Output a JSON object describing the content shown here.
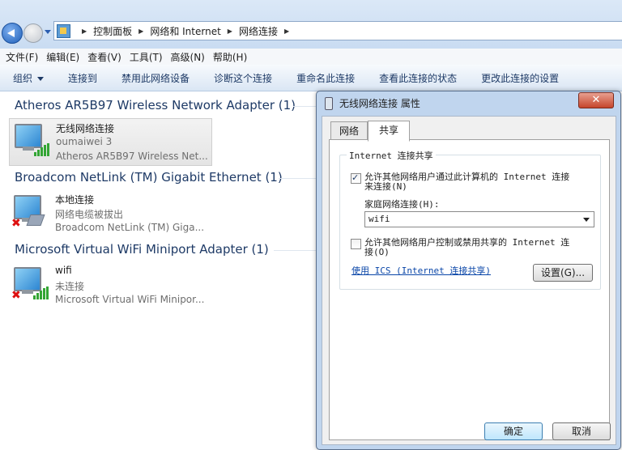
{
  "breadcrumb": [
    "控制面板",
    "网络和 Internet",
    "网络连接"
  ],
  "menu": [
    "文件(F)",
    "编辑(E)",
    "查看(V)",
    "工具(T)",
    "高级(N)",
    "帮助(H)"
  ],
  "toolbar": {
    "organize": "组织",
    "items": [
      "连接到",
      "禁用此网络设备",
      "诊断这个连接",
      "重命名此连接",
      "查看此连接的状态",
      "更改此连接的设置"
    ]
  },
  "groups": [
    {
      "title": "Atheros AR5B97 Wireless Network Adapter (1)",
      "adapter": {
        "name": "无线网络连接",
        "status": "oumaiwei  3",
        "device": "Atheros AR5B97 Wireless Net..."
      }
    },
    {
      "title": "Broadcom NetLink (TM) Gigabit Ethernet (1)",
      "adapter": {
        "name": "本地连接",
        "status": "网络电缆被拔出",
        "device": "Broadcom NetLink (TM) Giga..."
      }
    },
    {
      "title": "Microsoft Virtual WiFi Miniport Adapter (1)",
      "adapter": {
        "name": "wifi",
        "status": "未连接",
        "device": "Microsoft Virtual WiFi Minipor..."
      }
    }
  ],
  "dialog": {
    "title": "无线网络连接 属性",
    "close": "✕",
    "tabs": [
      "网络",
      "共享"
    ],
    "active_tab": "共享",
    "section": "Internet 连接共享",
    "allow_share": {
      "line1": "允许其他网络用户通过此计算机的 Internet 连接",
      "line2": "来连接(N)",
      "checked": true
    },
    "home_label": "家庭网络连接(H):",
    "home_value": "wifi",
    "allow_control": {
      "line1": "允许其他网络用户控制或禁用共享的 Internet 连",
      "line2": "接(O)",
      "checked": false
    },
    "ics_link": "使用 ICS (Internet 连接共享)",
    "settings": "设置(G)...",
    "ok": "确定",
    "cancel": "取消"
  }
}
